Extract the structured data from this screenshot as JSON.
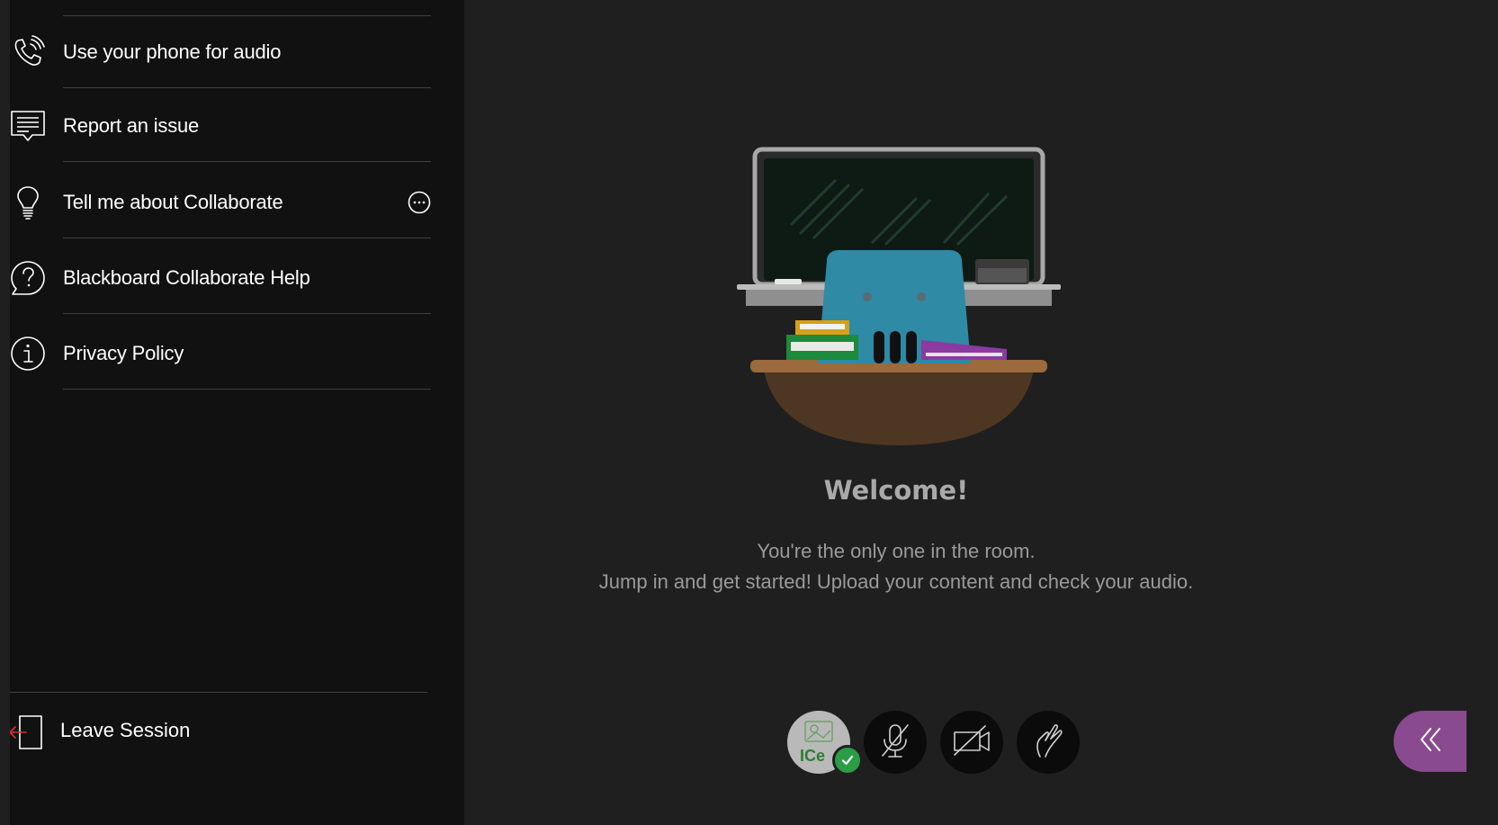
{
  "menu": {
    "items": [
      {
        "label": "Use your phone for audio",
        "icon": "phone-audio-icon"
      },
      {
        "label": "Report an issue",
        "icon": "report-issue-icon"
      },
      {
        "label": "Tell me about Collaborate",
        "icon": "lightbulb-icon",
        "has_more": true
      },
      {
        "label": "Blackboard Collaborate Help",
        "icon": "help-icon"
      },
      {
        "label": "Privacy Policy",
        "icon": "info-icon"
      }
    ],
    "leave_session_label": "Leave Session"
  },
  "stage": {
    "welcome_title": "Welcome!",
    "line1": "You're the only one in the room.",
    "line2": "Jump in and get started! Upload your content and check your audio."
  },
  "controls": {
    "avatar_initials": "ICe",
    "status": "connected",
    "microphone": "off",
    "camera": "off",
    "hand_raised": false
  },
  "colors": {
    "panel_bg": "#111111",
    "stage_bg": "#1f1f1f",
    "accent_purple": "#8a4a8f",
    "success_green": "#2a9d45",
    "leave_red": "#d9302a"
  }
}
